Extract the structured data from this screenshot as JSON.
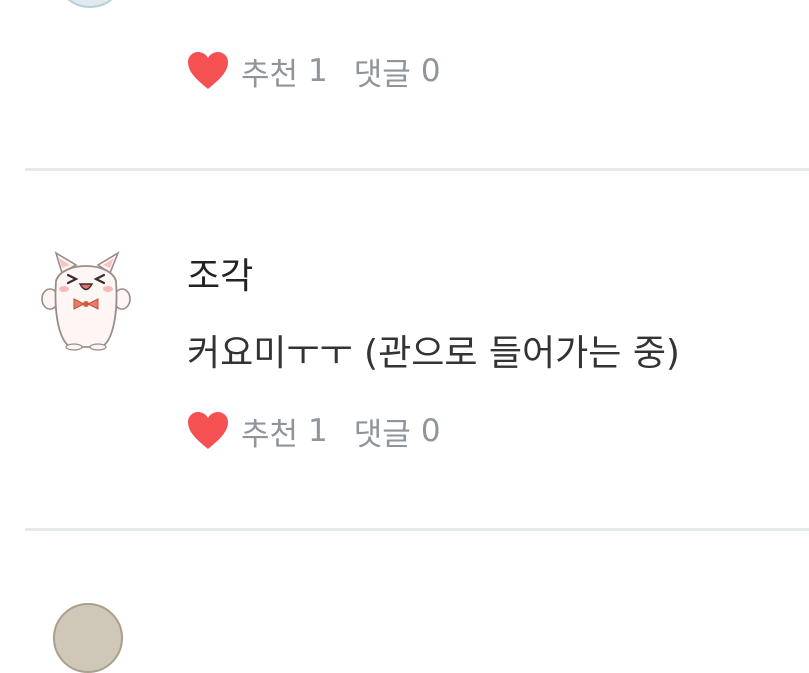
{
  "posts": [
    {
      "author": "",
      "content": "",
      "like_label": "추천",
      "like_count": "1",
      "comment_label": "댓글",
      "comment_count": "0"
    },
    {
      "author": "조각",
      "content": "커요미ㅜㅜ (관으로 들어가는 중)",
      "like_label": "추천",
      "like_count": "1",
      "comment_label": "댓글",
      "comment_count": "0"
    }
  ],
  "colors": {
    "heart": "#f55152",
    "meta_text": "#8f959a",
    "divider": "#e6e9ec"
  },
  "icons": {
    "like": "heart-icon",
    "avatar": "cat-avatar-icon"
  }
}
